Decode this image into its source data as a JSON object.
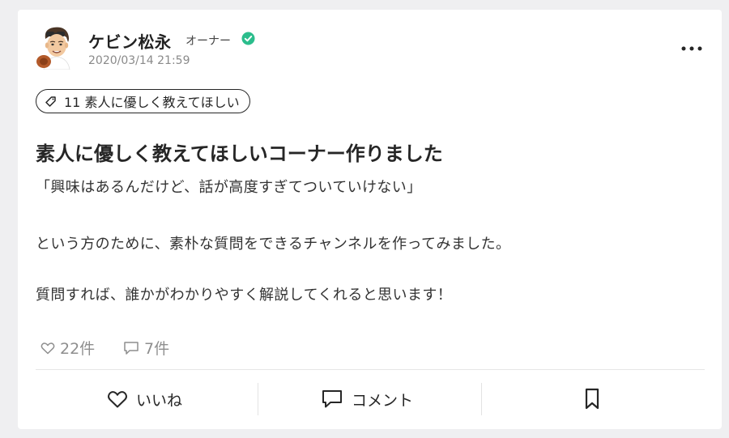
{
  "post": {
    "author": {
      "name": "ケビン松永",
      "role": "オーナー",
      "verified": true
    },
    "date": "2020/03/14 21:59",
    "tag": {
      "label": "11 素人に優しく教えてほしい",
      "icon": "tag-icon"
    },
    "title": "素人に優しく教えてほしいコーナー作りました",
    "body": [
      "「興味はあるんだけど、話が高度すぎてついていけない」",
      "という方のために、素朴な質問をできるチャンネルを作ってみました。",
      "質問すれば、誰かがわかりやすく解説してくれると思います！"
    ],
    "stats": {
      "likes": "22件",
      "comments": "7件"
    },
    "actions": {
      "like": "いいね",
      "comment": "コメント"
    }
  },
  "colors": {
    "verified_badge": "#2bbd8c",
    "card_background": "#ffffff",
    "page_background": "#efeff1"
  }
}
